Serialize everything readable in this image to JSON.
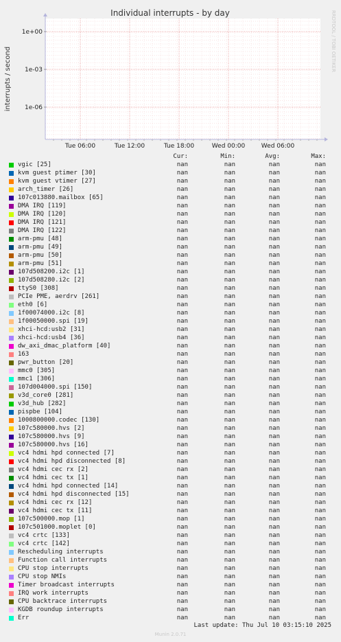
{
  "chart_data": {
    "type": "line",
    "title": "Individual interrupts - by day",
    "ylabel": "interrupts / second",
    "yscale": "log",
    "y_ticks": [
      "1e+00",
      "1e-03",
      "1e-06"
    ],
    "x_ticks": [
      "Tue 06:00",
      "Tue 12:00",
      "Tue 18:00",
      "Wed 00:00",
      "Wed 06:00"
    ],
    "grid": true,
    "series_values": "nan"
  },
  "side_text": "RRDTOOL / TOBI OETIKER",
  "legend_headers": {
    "cur": "Cur:",
    "min": "Min:",
    "avg": "Avg:",
    "max": "Max:"
  },
  "legend": [
    {
      "label": "vgic [25]",
      "color": "#00cc00",
      "cur": "nan",
      "min": "nan",
      "avg": "nan",
      "max": "nan"
    },
    {
      "label": "kvm guest ptimer [30]",
      "color": "#0066b3",
      "cur": "nan",
      "min": "nan",
      "avg": "nan",
      "max": "nan"
    },
    {
      "label": "kvm guest vtimer [27]",
      "color": "#ff8000",
      "cur": "nan",
      "min": "nan",
      "avg": "nan",
      "max": "nan"
    },
    {
      "label": "arch_timer [26]",
      "color": "#ffcc00",
      "cur": "nan",
      "min": "nan",
      "avg": "nan",
      "max": "nan"
    },
    {
      "label": "107c013880.mailbox [65]",
      "color": "#330099",
      "cur": "nan",
      "min": "nan",
      "avg": "nan",
      "max": "nan"
    },
    {
      "label": "DMA IRQ [119]",
      "color": "#990099",
      "cur": "nan",
      "min": "nan",
      "avg": "nan",
      "max": "nan"
    },
    {
      "label": "DMA IRQ [120]",
      "color": "#ccff00",
      "cur": "nan",
      "min": "nan",
      "avg": "nan",
      "max": "nan"
    },
    {
      "label": "DMA IRQ [121]",
      "color": "#ff0000",
      "cur": "nan",
      "min": "nan",
      "avg": "nan",
      "max": "nan"
    },
    {
      "label": "DMA IRQ [122]",
      "color": "#808080",
      "cur": "nan",
      "min": "nan",
      "avg": "nan",
      "max": "nan"
    },
    {
      "label": "arm-pmu [48]",
      "color": "#008f00",
      "cur": "nan",
      "min": "nan",
      "avg": "nan",
      "max": "nan"
    },
    {
      "label": "arm-pmu [49]",
      "color": "#00487d",
      "cur": "nan",
      "min": "nan",
      "avg": "nan",
      "max": "nan"
    },
    {
      "label": "arm-pmu [50]",
      "color": "#b35a00",
      "cur": "nan",
      "min": "nan",
      "avg": "nan",
      "max": "nan"
    },
    {
      "label": "arm-pmu [51]",
      "color": "#b38f00",
      "cur": "nan",
      "min": "nan",
      "avg": "nan",
      "max": "nan"
    },
    {
      "label": "107d508200.i2c [1]",
      "color": "#6b006b",
      "cur": "nan",
      "min": "nan",
      "avg": "nan",
      "max": "nan"
    },
    {
      "label": "107d508280.i2c [2]",
      "color": "#8fb300",
      "cur": "nan",
      "min": "nan",
      "avg": "nan",
      "max": "nan"
    },
    {
      "label": "ttyS0 [308]",
      "color": "#b30000",
      "cur": "nan",
      "min": "nan",
      "avg": "nan",
      "max": "nan"
    },
    {
      "label": "PCIe PME, aerdrv [261]",
      "color": "#bebebe",
      "cur": "nan",
      "min": "nan",
      "avg": "nan",
      "max": "nan"
    },
    {
      "label": "eth0 [6]",
      "color": "#80ff80",
      "cur": "nan",
      "min": "nan",
      "avg": "nan",
      "max": "nan"
    },
    {
      "label": "1f00074000.i2c [8]",
      "color": "#80c9ff",
      "cur": "nan",
      "min": "nan",
      "avg": "nan",
      "max": "nan"
    },
    {
      "label": "1f00050000.spi [19]",
      "color": "#ffc080",
      "cur": "nan",
      "min": "nan",
      "avg": "nan",
      "max": "nan"
    },
    {
      "label": "xhci-hcd:usb2 [31]",
      "color": "#ffe680",
      "cur": "nan",
      "min": "nan",
      "avg": "nan",
      "max": "nan"
    },
    {
      "label": "xhci-hcd:usb4 [36]",
      "color": "#aa80ff",
      "cur": "nan",
      "min": "nan",
      "avg": "nan",
      "max": "nan"
    },
    {
      "label": "dw_axi_dmac_platform [40]",
      "color": "#ee00cc",
      "cur": "nan",
      "min": "nan",
      "avg": "nan",
      "max": "nan"
    },
    {
      "label": "163",
      "color": "#ff8080",
      "cur": "nan",
      "min": "nan",
      "avg": "nan",
      "max": "nan"
    },
    {
      "label": "pwr_button [20]",
      "color": "#666600",
      "cur": "nan",
      "min": "nan",
      "avg": "nan",
      "max": "nan"
    },
    {
      "label": "mmc0 [305]",
      "color": "#ffbfff",
      "cur": "nan",
      "min": "nan",
      "avg": "nan",
      "max": "nan"
    },
    {
      "label": "mmc1 [306]",
      "color": "#00ffcc",
      "cur": "nan",
      "min": "nan",
      "avg": "nan",
      "max": "nan"
    },
    {
      "label": "107d004000.spi [150]",
      "color": "#cc6699",
      "cur": "nan",
      "min": "nan",
      "avg": "nan",
      "max": "nan"
    },
    {
      "label": "v3d_core0 [281]",
      "color": "#999900",
      "cur": "nan",
      "min": "nan",
      "avg": "nan",
      "max": "nan"
    },
    {
      "label": "v3d_hub [282]",
      "color": "#00cc00",
      "cur": "nan",
      "min": "nan",
      "avg": "nan",
      "max": "nan"
    },
    {
      "label": "pispbe [104]",
      "color": "#0066b3",
      "cur": "nan",
      "min": "nan",
      "avg": "nan",
      "max": "nan"
    },
    {
      "label": "1000800000.codec [130]",
      "color": "#ff8000",
      "cur": "nan",
      "min": "nan",
      "avg": "nan",
      "max": "nan"
    },
    {
      "label": "107c580000.hvs [2]",
      "color": "#ffcc00",
      "cur": "nan",
      "min": "nan",
      "avg": "nan",
      "max": "nan"
    },
    {
      "label": "107c580000.hvs [9]",
      "color": "#330099",
      "cur": "nan",
      "min": "nan",
      "avg": "nan",
      "max": "nan"
    },
    {
      "label": "107c580000.hvs [16]",
      "color": "#990099",
      "cur": "nan",
      "min": "nan",
      "avg": "nan",
      "max": "nan"
    },
    {
      "label": "vc4 hdmi hpd connected [7]",
      "color": "#ccff00",
      "cur": "nan",
      "min": "nan",
      "avg": "nan",
      "max": "nan"
    },
    {
      "label": "vc4 hdmi hpd disconnected [8]",
      "color": "#ff0000",
      "cur": "nan",
      "min": "nan",
      "avg": "nan",
      "max": "nan"
    },
    {
      "label": "vc4 hdmi cec rx [2]",
      "color": "#808080",
      "cur": "nan",
      "min": "nan",
      "avg": "nan",
      "max": "nan"
    },
    {
      "label": "vc4 hdmi cec tx [1]",
      "color": "#008f00",
      "cur": "nan",
      "min": "nan",
      "avg": "nan",
      "max": "nan"
    },
    {
      "label": "vc4 hdmi hpd connected [14]",
      "color": "#00487d",
      "cur": "nan",
      "min": "nan",
      "avg": "nan",
      "max": "nan"
    },
    {
      "label": "vc4 hdmi hpd disconnected [15]",
      "color": "#b35a00",
      "cur": "nan",
      "min": "nan",
      "avg": "nan",
      "max": "nan"
    },
    {
      "label": "vc4 hdmi cec rx [12]",
      "color": "#b38f00",
      "cur": "nan",
      "min": "nan",
      "avg": "nan",
      "max": "nan"
    },
    {
      "label": "vc4 hdmi cec tx [11]",
      "color": "#6b006b",
      "cur": "nan",
      "min": "nan",
      "avg": "nan",
      "max": "nan"
    },
    {
      "label": "107c500000.mop [1]",
      "color": "#8fb300",
      "cur": "nan",
      "min": "nan",
      "avg": "nan",
      "max": "nan"
    },
    {
      "label": "107c501000.moplet [0]",
      "color": "#b30000",
      "cur": "nan",
      "min": "nan",
      "avg": "nan",
      "max": "nan"
    },
    {
      "label": "vc4 crtc [133]",
      "color": "#bebebe",
      "cur": "nan",
      "min": "nan",
      "avg": "nan",
      "max": "nan"
    },
    {
      "label": "vc4 crtc [142]",
      "color": "#80ff80",
      "cur": "nan",
      "min": "nan",
      "avg": "nan",
      "max": "nan"
    },
    {
      "label": "Rescheduling interrupts",
      "color": "#80c9ff",
      "cur": "nan",
      "min": "nan",
      "avg": "nan",
      "max": "nan"
    },
    {
      "label": "Function call interrupts",
      "color": "#ffc080",
      "cur": "nan",
      "min": "nan",
      "avg": "nan",
      "max": "nan"
    },
    {
      "label": "CPU stop interrupts",
      "color": "#ffe680",
      "cur": "nan",
      "min": "nan",
      "avg": "nan",
      "max": "nan"
    },
    {
      "label": "CPU stop NMIs",
      "color": "#aa80ff",
      "cur": "nan",
      "min": "nan",
      "avg": "nan",
      "max": "nan"
    },
    {
      "label": "Timer broadcast interrupts",
      "color": "#ee00cc",
      "cur": "nan",
      "min": "nan",
      "avg": "nan",
      "max": "nan"
    },
    {
      "label": "IRQ work interrupts",
      "color": "#ff8080",
      "cur": "nan",
      "min": "nan",
      "avg": "nan",
      "max": "nan"
    },
    {
      "label": "CPU backtrace interrupts",
      "color": "#666600",
      "cur": "nan",
      "min": "nan",
      "avg": "nan",
      "max": "nan"
    },
    {
      "label": "KGDB roundup interrupts",
      "color": "#ffbfff",
      "cur": "nan",
      "min": "nan",
      "avg": "nan",
      "max": "nan"
    },
    {
      "label": "Err",
      "color": "#00ffcc",
      "cur": "nan",
      "min": "nan",
      "avg": "nan",
      "max": "nan"
    }
  ],
  "last_update": "Last update: Thu Jul 10 03:15:10 2025",
  "version": "Munin 2.0.71"
}
